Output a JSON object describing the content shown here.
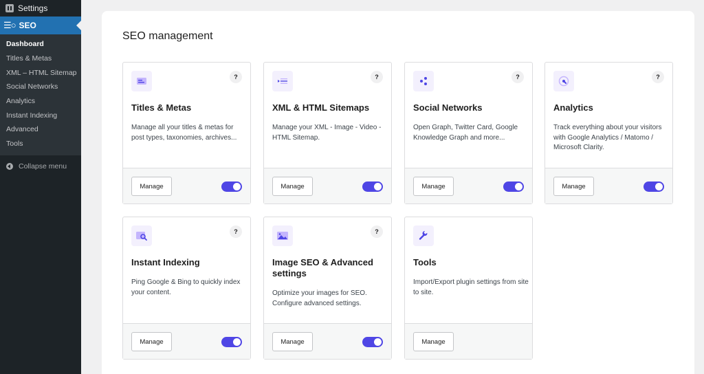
{
  "sidebar": {
    "settings_label": "Settings",
    "seo_label": "SEO",
    "items": [
      {
        "label": "Dashboard"
      },
      {
        "label": "Titles & Metas"
      },
      {
        "label": "XML – HTML Sitemap"
      },
      {
        "label": "Social Networks"
      },
      {
        "label": "Analytics"
      },
      {
        "label": "Instant Indexing"
      },
      {
        "label": "Advanced"
      },
      {
        "label": "Tools"
      }
    ],
    "collapse_label": "Collapse menu"
  },
  "main": {
    "title": "SEO management",
    "cards": [
      {
        "title": "Titles & Metas",
        "description": "Manage all your titles & metas for post types, taxonomies, archives...",
        "button": "Manage",
        "help": "?",
        "enabled": true,
        "icon": "list-icon"
      },
      {
        "title": "XML & HTML Sitemaps",
        "description": "Manage your XML - Image - Video - HTML Sitemap.",
        "button": "Manage",
        "help": "?",
        "enabled": true,
        "icon": "sitemap-icon"
      },
      {
        "title": "Social Networks",
        "description": "Open Graph, Twitter Card, Google Knowledge Graph and more...",
        "button": "Manage",
        "help": "?",
        "enabled": true,
        "icon": "share-icon"
      },
      {
        "title": "Analytics",
        "description": "Track everything about your visitors with Google Analytics / Matomo / Microsoft Clarity.",
        "button": "Manage",
        "help": "?",
        "enabled": true,
        "icon": "analytics-icon"
      },
      {
        "title": "Instant Indexing",
        "description": "Ping Google & Bing to quickly index your content.",
        "button": "Manage",
        "help": "?",
        "enabled": true,
        "icon": "indexing-icon"
      },
      {
        "title": "Image SEO & Advanced settings",
        "description": "Optimize your images for SEO. Configure advanced settings.",
        "button": "Manage",
        "help": "?",
        "enabled": true,
        "icon": "image-icon"
      },
      {
        "title": "Tools",
        "description": "Import/Export plugin settings from site to site.",
        "button": "Manage",
        "icon": "wrench-icon"
      }
    ]
  },
  "colors": {
    "accent": "#4f46e5",
    "sidebar_bg": "#1d2327",
    "sidebar_active": "#2271b1"
  }
}
